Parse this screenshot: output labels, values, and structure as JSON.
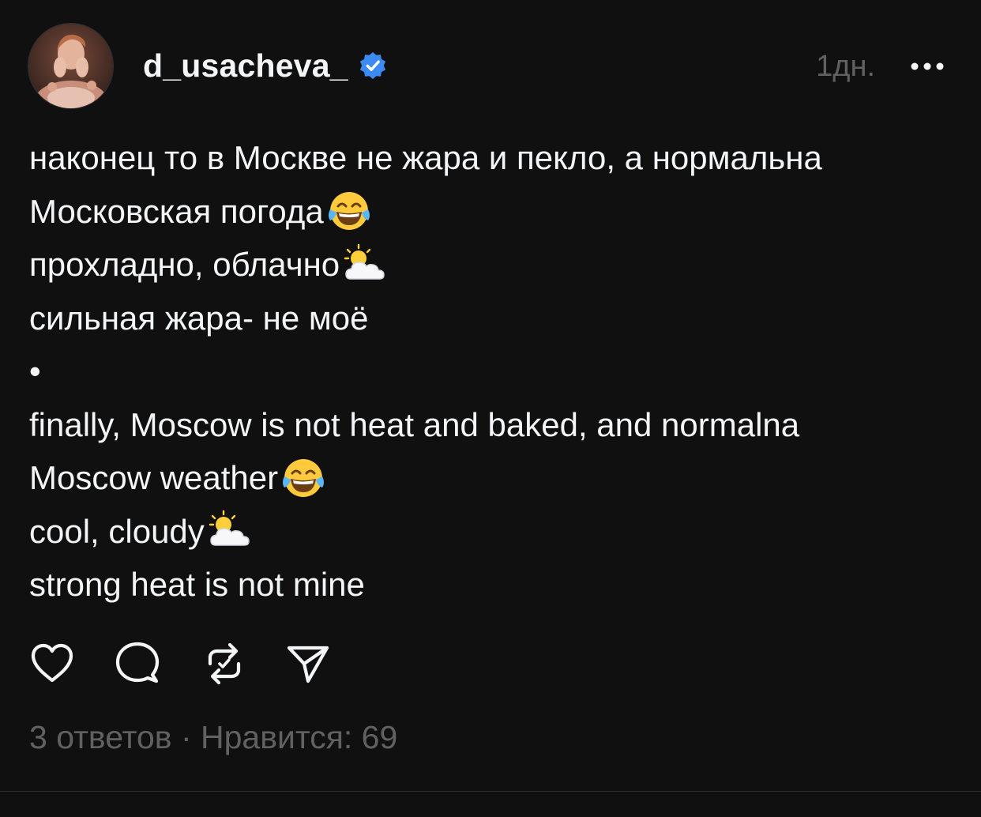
{
  "post": {
    "author": {
      "username": "d_usacheva_",
      "verified": true,
      "verified_color": "#3c8bf5"
    },
    "timestamp": "1дн.",
    "text_lines": [
      {
        "text": "наконец то в Москве не жара и пекло, а нормальна",
        "emoji": null
      },
      {
        "text": "Московская погода",
        "emoji": "tears-of-joy-emoji"
      },
      {
        "text": "прохладно, облачно ",
        "emoji": "sun-behind-cloud-emoji"
      },
      {
        "text": "сильная жара- не моё",
        "emoji": null
      },
      {
        "text": "•",
        "emoji": null
      },
      {
        "text": "finally, Moscow is not heat and baked, and normalna",
        "emoji": null
      },
      {
        "text": "Moscow weather",
        "emoji": "tears-of-joy-emoji"
      },
      {
        "text": "cool, cloudy ",
        "emoji": "sun-behind-cloud-emoji"
      },
      {
        "text": "strong heat is not mine",
        "emoji": null
      }
    ],
    "actions": {
      "like_icon": "heart-icon",
      "reply_icon": "comment-icon",
      "repost_icon": "repost-icon",
      "share_icon": "send-icon"
    },
    "stats": {
      "replies": "3 ответов",
      "separator": " · ",
      "likes": "Нравится: 69"
    }
  },
  "colors": {
    "background": "#101010",
    "text": "#f3f5f7",
    "muted": "#616161"
  }
}
